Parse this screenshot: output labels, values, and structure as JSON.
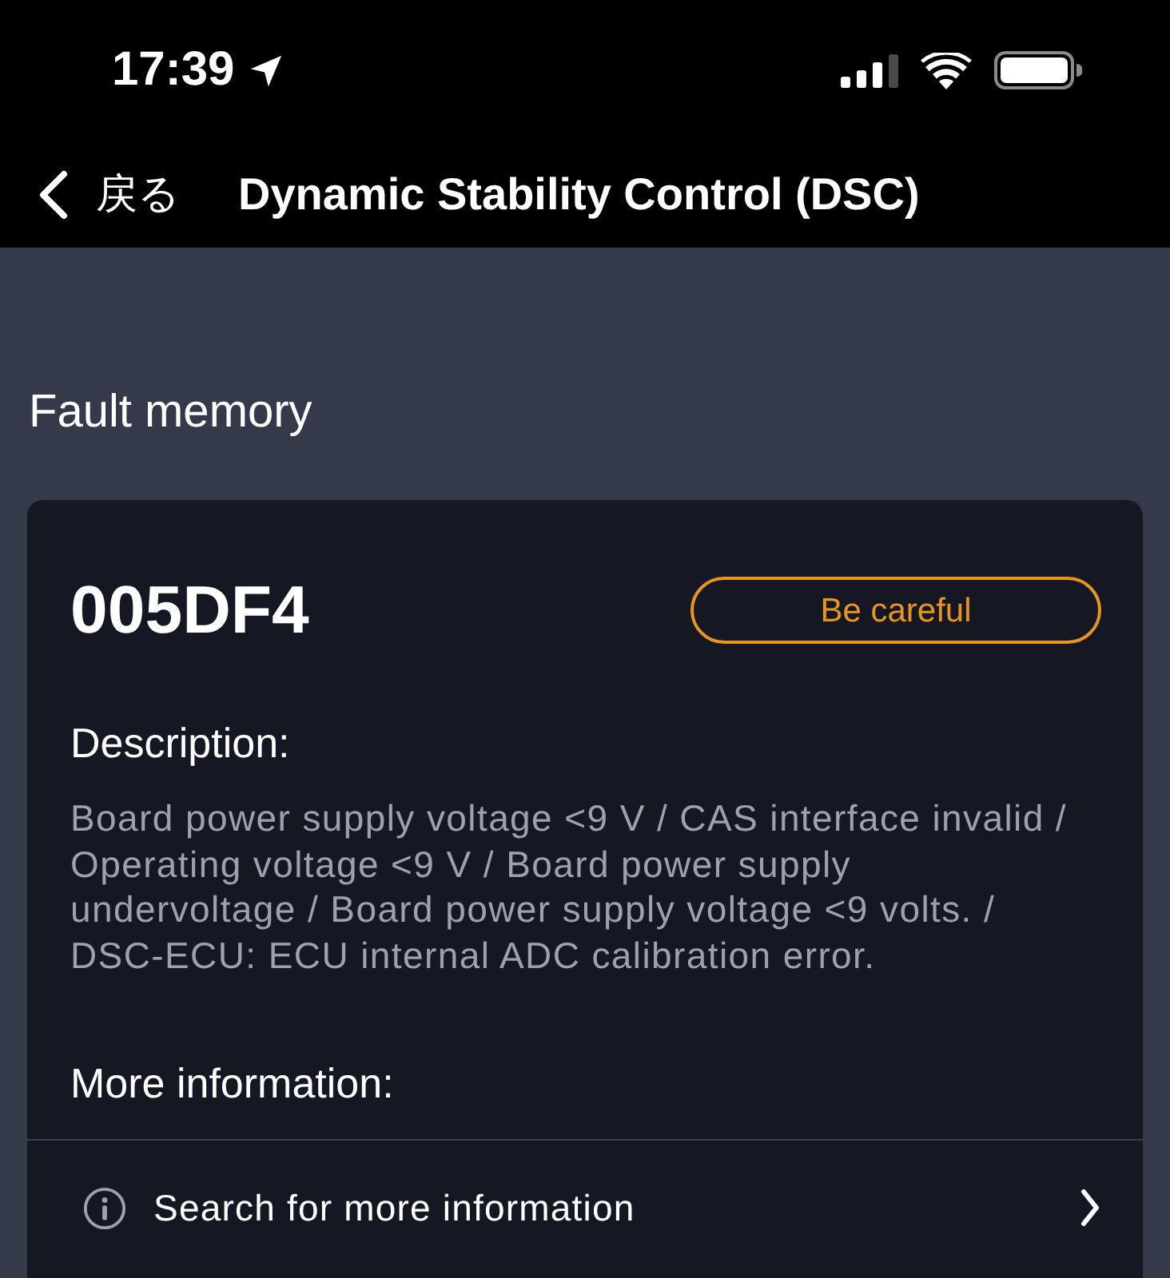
{
  "status_bar": {
    "time": "17:39"
  },
  "nav_bar": {
    "back_label": "戻る",
    "title": "Dynamic Stability Control (DSC)"
  },
  "section_title": "Fault memory",
  "fault": {
    "code": "005DF4",
    "severity": {
      "kind": "caution",
      "label": "Be careful"
    },
    "description_label": "Description:",
    "description": "Board power supply voltage <9 V / CAS interface invalid / Operating voltage <9 V / Board power supply undervoltage / Board power supply voltage <9 volts. / DSC-ECU: ECU internal ADC calibration error.",
    "more_info_label": "More information:",
    "links": [
      {
        "label": "Search for more information"
      }
    ]
  }
}
